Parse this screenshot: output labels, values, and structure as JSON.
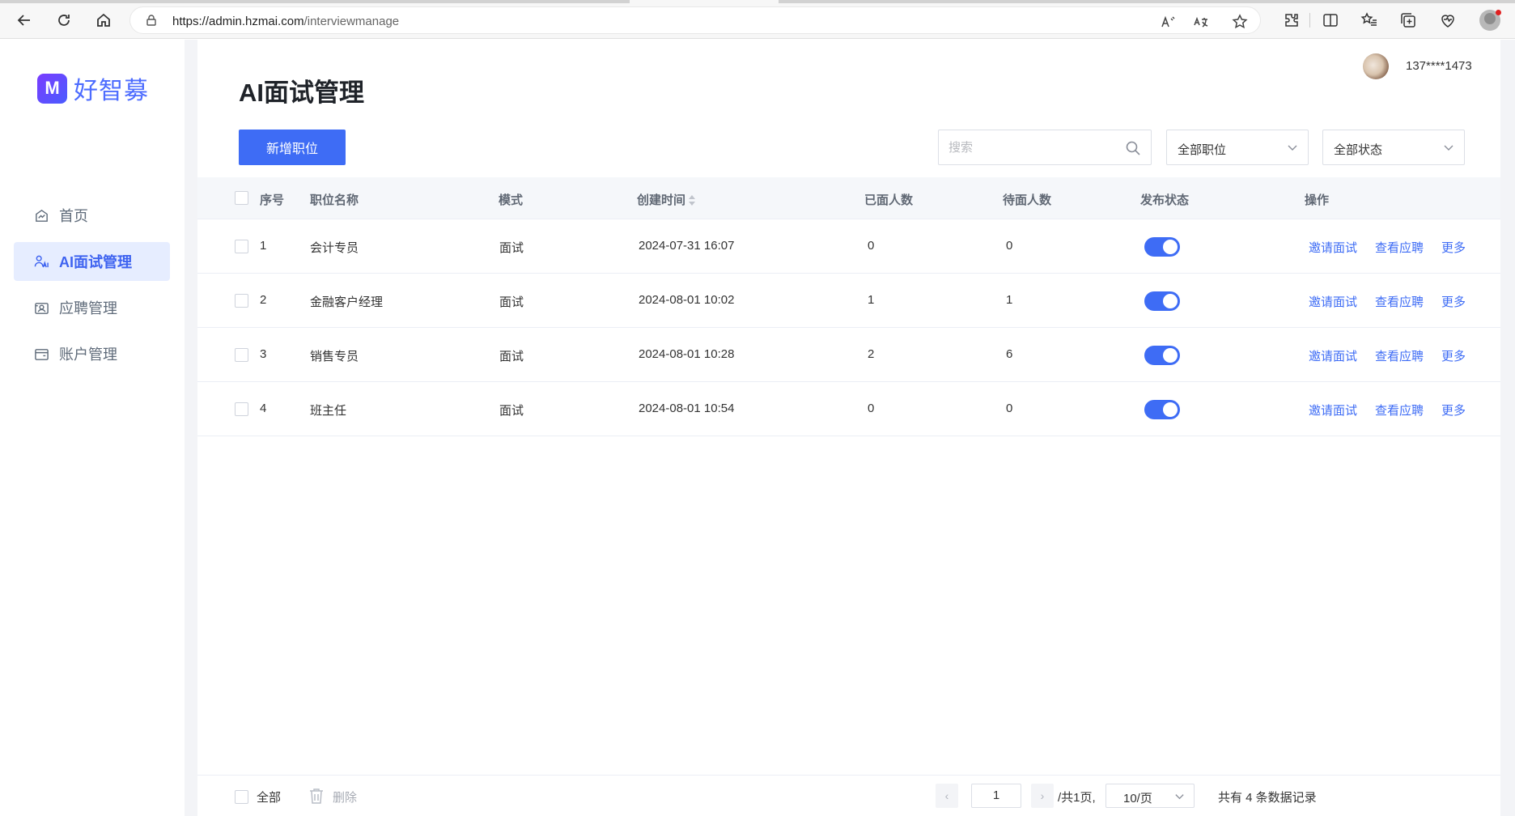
{
  "browser": {
    "url_host": "https://admin.hzmai.com",
    "url_path": "/interviewmanage"
  },
  "brand": {
    "logo_letter": "M",
    "name": "好智募",
    "accent_color": "#3e6cf5"
  },
  "sidebar": {
    "items": [
      {
        "label": "首页",
        "icon": "home-chart-icon",
        "active": false
      },
      {
        "label": "AI面试管理",
        "icon": "ai-person-icon",
        "active": true
      },
      {
        "label": "应聘管理",
        "icon": "profile-card-icon",
        "active": false
      },
      {
        "label": "账户管理",
        "icon": "wallet-icon",
        "active": false
      }
    ]
  },
  "header": {
    "user_phone": "137****1473"
  },
  "page": {
    "title": "AI面试管理",
    "add_button": "新增职位",
    "search_placeholder": "搜索",
    "filter_position": "全部职位",
    "filter_status": "全部状态"
  },
  "table": {
    "columns": [
      "序号",
      "职位名称",
      "模式",
      "创建时间",
      "已面人数",
      "待面人数",
      "发布状态",
      "操作"
    ],
    "rows": [
      {
        "index": "1",
        "name": "会计专员",
        "mode": "面试",
        "created": "2024-07-31 16:07",
        "done": "0",
        "pending": "0",
        "published": true
      },
      {
        "index": "2",
        "name": "金融客户经理",
        "mode": "面试",
        "created": "2024-08-01 10:02",
        "done": "1",
        "pending": "1",
        "published": true
      },
      {
        "index": "3",
        "name": "销售专员",
        "mode": "面试",
        "created": "2024-08-01 10:28",
        "done": "2",
        "pending": "6",
        "published": true
      },
      {
        "index": "4",
        "name": "班主任",
        "mode": "面试",
        "created": "2024-08-01 10:54",
        "done": "0",
        "pending": "0",
        "published": true
      }
    ],
    "actions": {
      "invite": "邀请面试",
      "view": "查看应聘",
      "more": "更多"
    }
  },
  "footer": {
    "select_all": "全部",
    "delete": "删除",
    "current_page": "1",
    "total_pages": "/共1页,",
    "page_size": "10/页",
    "records": "共有 4 条数据记录"
  }
}
